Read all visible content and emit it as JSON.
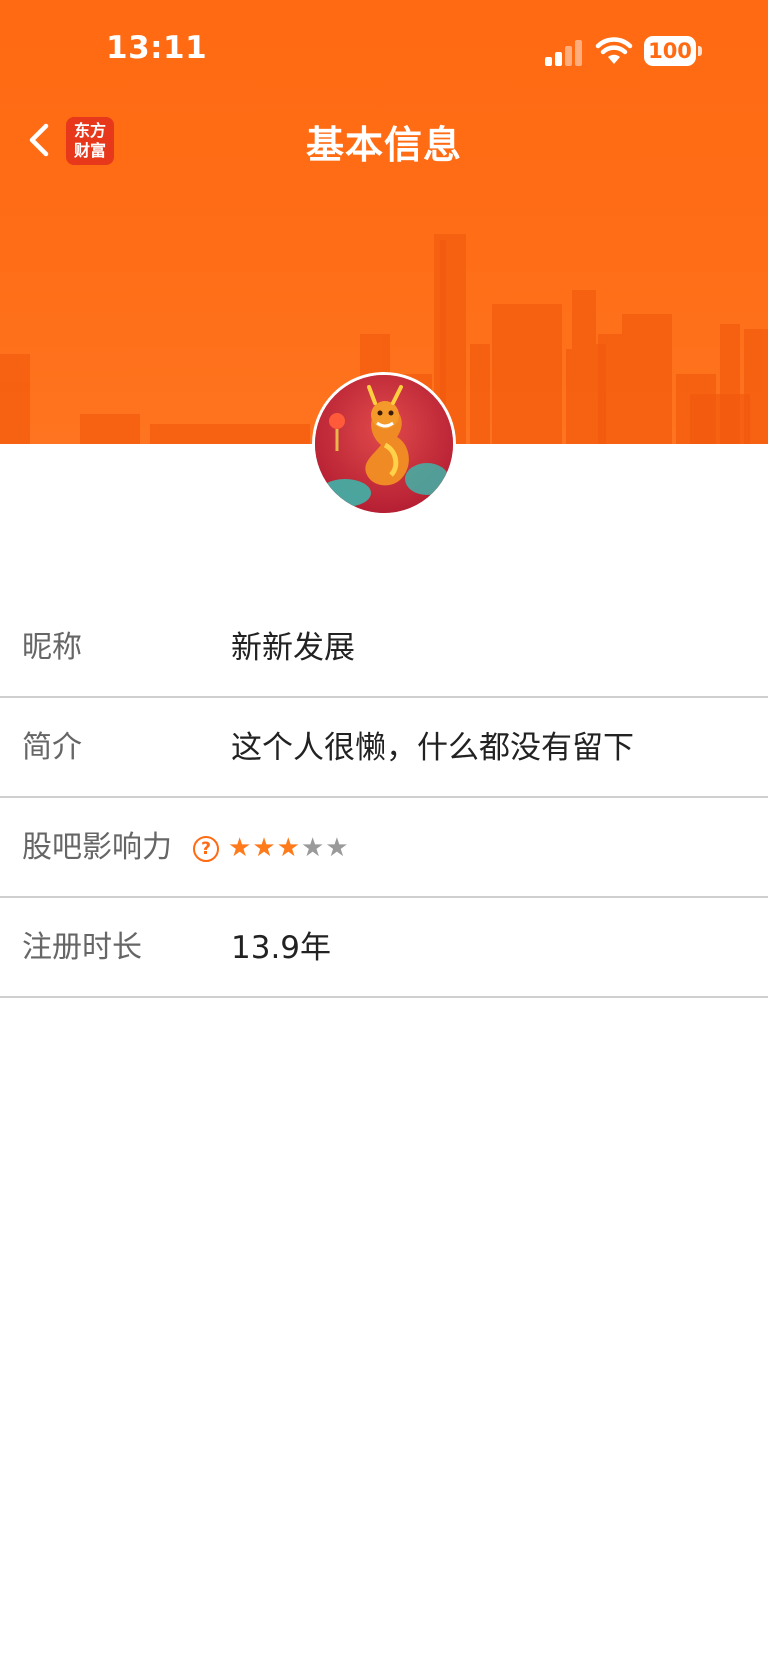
{
  "status_bar": {
    "time": "13:11",
    "battery": "100"
  },
  "nav": {
    "title": "基本信息",
    "logo_line1": "东方",
    "logo_line2": "财富"
  },
  "rows": [
    {
      "label": "昵称",
      "value": "新新发展"
    },
    {
      "label": "简介",
      "value": "这个人很懒，什么都没有留下"
    },
    {
      "label": "股吧影响力",
      "help": "?",
      "rating": 3,
      "rating_max": 5
    },
    {
      "label": "注册时长",
      "value": "13.9年"
    }
  ],
  "colors": {
    "accent": "#ff6a12",
    "star_active": "#ff7a1a",
    "star_inactive": "#9a9a9a"
  },
  "icons": {
    "back": "chevron-left-icon",
    "help": "question-circle-icon",
    "star": "star-icon"
  }
}
